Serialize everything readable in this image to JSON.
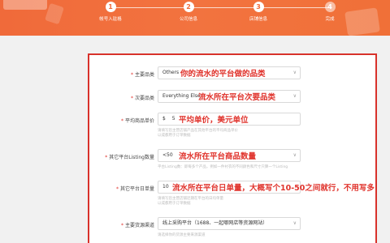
{
  "steps": [
    {
      "num": "1",
      "label": "帐号入驻格"
    },
    {
      "num": "2",
      "label": "公司信息"
    },
    {
      "num": "3",
      "label": "店铺信息"
    },
    {
      "num": "4",
      "label": "完成"
    }
  ],
  "form": {
    "main_category": {
      "label": "主要品类",
      "value": "Others",
      "note": "你的流水的平台做的品类"
    },
    "sub_category": {
      "label": "次要品类",
      "value": "Everything Else",
      "note": "流水所在平台次要品类"
    },
    "avg_price": {
      "label": "平均商品单价",
      "currency": "$",
      "value": "5",
      "note": "平均单价，美元单位",
      "hint1": "请填写您主营店铺产品在其他平台的平均商品单价",
      "hint2": "以成都用于订单数据"
    },
    "listing_count": {
      "label": "其它平台Listing数量",
      "value": "<50",
      "note": "流水所在平台商品数量",
      "hint1": "平台Listing数：即每多个产品，例如一件衬衣的不同颜色和尺寸只算一个Listing"
    },
    "daily_orders": {
      "label": "其它平台日单量",
      "value": "10",
      "note": "流水所在平台日单量，大概写个10-50之间就行，不用写多",
      "hint1": "请填写您主营店铺近期在平台的日均单量",
      "hint2": "以成都用于订单数据"
    },
    "supply_channel": {
      "label": "主要货源渠道",
      "value": "线上采购平台（1688、一起哪网店等资源网站）",
      "hint1": "请选择你的货源主要来源渠道"
    }
  }
}
